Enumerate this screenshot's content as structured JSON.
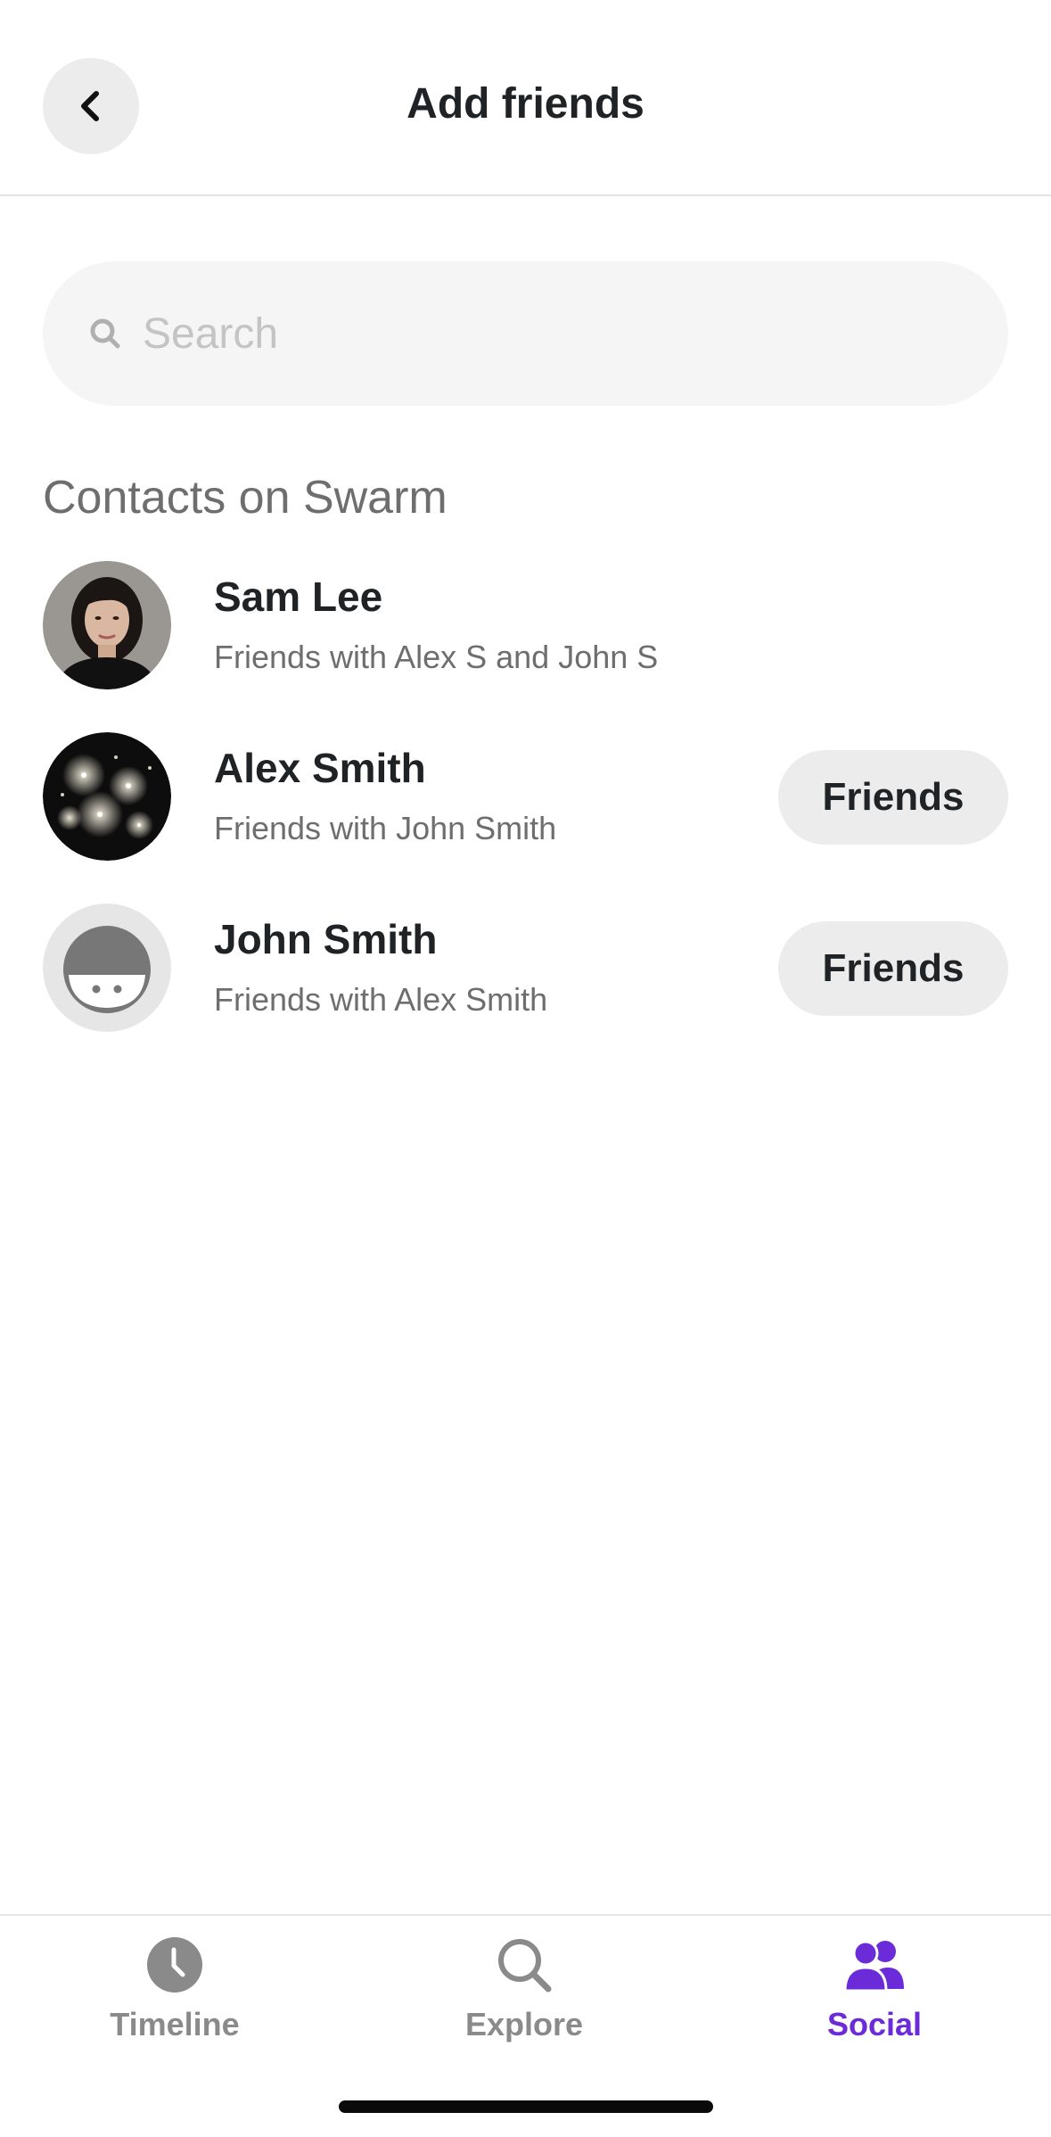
{
  "header": {
    "title": "Add friends"
  },
  "search": {
    "placeholder": "Search",
    "value": ""
  },
  "contacts_section": {
    "title": "Contacts on Swarm",
    "contacts": [
      {
        "name": "Sam Lee",
        "subtitle": "Friends with Alex S and John S",
        "avatar": "photo-portrait",
        "action_label": ""
      },
      {
        "name": "Alex Smith",
        "subtitle": "Friends with John Smith",
        "avatar": "photo-fireworks",
        "action_label": "Friends"
      },
      {
        "name": "John Smith",
        "subtitle": "Friends with Alex Smith",
        "avatar": "default-face",
        "action_label": "Friends"
      }
    ]
  },
  "bottom_nav": {
    "items": [
      {
        "label": "Timeline",
        "icon": "clock-icon",
        "active": false
      },
      {
        "label": "Explore",
        "icon": "search-icon",
        "active": false
      },
      {
        "label": "Social",
        "icon": "people-icon",
        "active": true
      }
    ]
  },
  "colors": {
    "accent": "#6c2bd9",
    "inactive": "#8a8a8a",
    "text_primary": "#1f2326",
    "text_secondary": "#6e6e6e",
    "button_bg": "#ececec"
  }
}
